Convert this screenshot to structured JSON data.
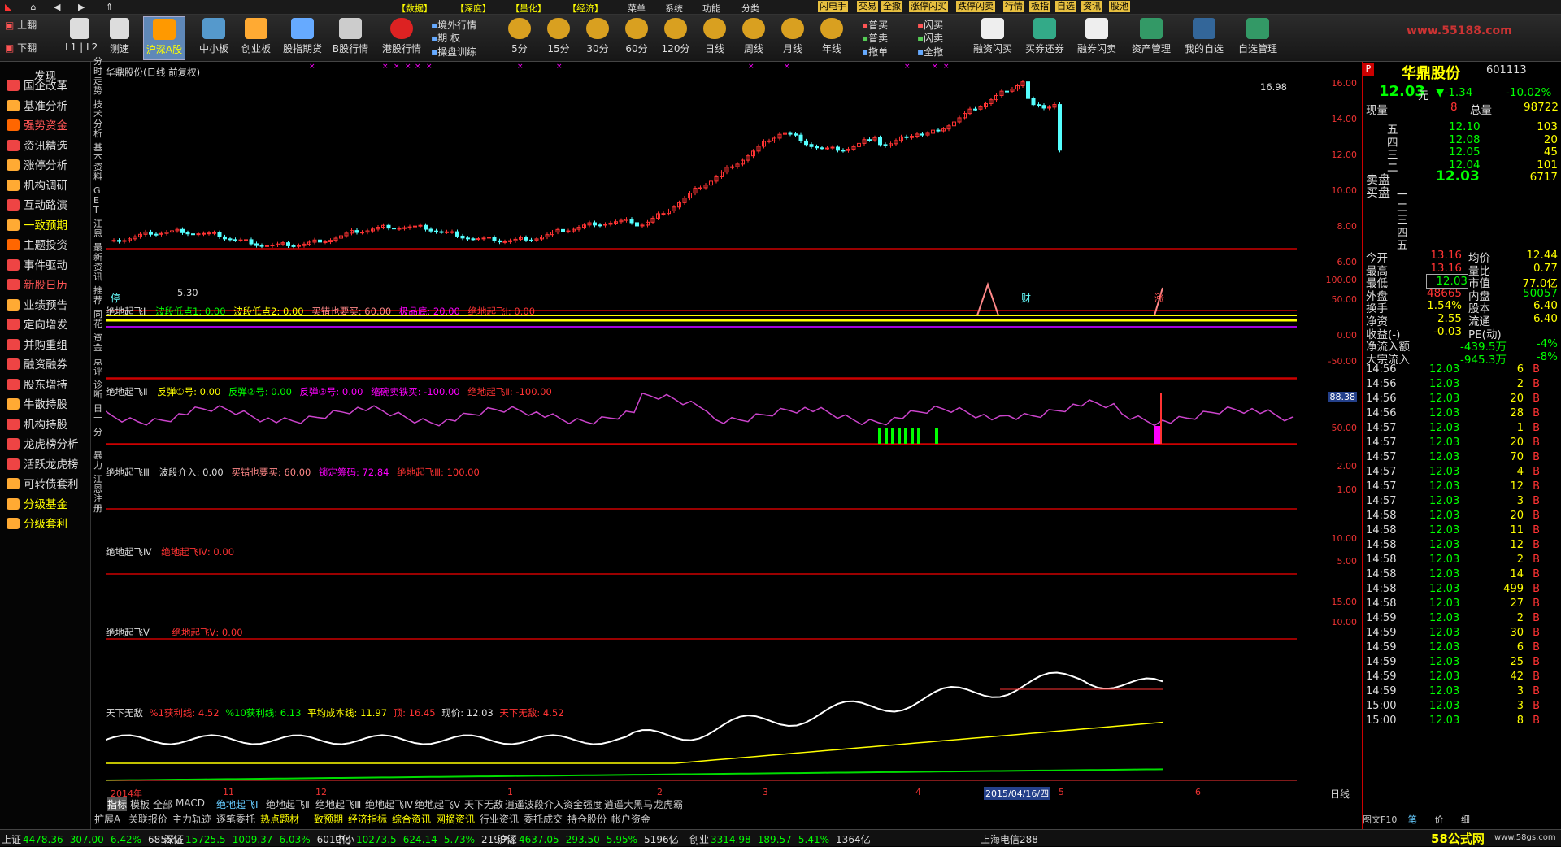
{
  "menubar": {
    "items": [
      "上翻",
      "下翻",
      "数据",
      "深度",
      "量化",
      "经济",
      "菜单",
      "系统",
      "功能",
      "分类",
      "闪电手",
      "交易",
      "全撒",
      "涨停闪买",
      "跌停闪卖",
      "行情",
      "板指",
      "自选",
      "资讯",
      "股池"
    ]
  },
  "toolbar": {
    "nav": [
      "上翻",
      "下翻"
    ],
    "l1l2": "L1 | L2",
    "buttons": [
      "测速",
      "沪深A股",
      "中小板",
      "创业板",
      "股指期货",
      "B股行情",
      "港股行情"
    ],
    "small": [
      "境外行情",
      "期 权",
      "操盘训练"
    ],
    "periods": [
      "5分",
      "15分",
      "30分",
      "60分",
      "120分",
      "日线",
      "周线",
      "月线",
      "年线"
    ],
    "trade1": [
      "普买",
      "普卖",
      "撤单"
    ],
    "trade2": [
      "闪买",
      "闪卖",
      "全撤"
    ],
    "right": [
      "融资闪买",
      "买券还券",
      "融券闪卖",
      "资产管理",
      "我的自选",
      "自选管理"
    ],
    "logo": "www.55188.com"
  },
  "sidebar": {
    "header": "发现",
    "items": [
      "国企改革",
      "基准分析",
      "强势资金",
      "资讯精选",
      "涨停分析",
      "机构调研",
      "互动路演",
      "一致预期",
      "主题投资",
      "事件驱动",
      "新股日历",
      "业绩预告",
      "定向增发",
      "并购重组",
      "融资融券",
      "股东增持",
      "牛散持股",
      "机构持股",
      "龙虎榜分析",
      "活跃龙虎榜",
      "可转债套利",
      "分级基金",
      "分级套利"
    ]
  },
  "vtabs": [
    "分时走势",
    "技术分析",
    "基本资料",
    "GET",
    "江恩",
    "最新资讯",
    "推荐",
    "同花",
    "资金",
    "点评",
    "诊断",
    "日十",
    "分十",
    "暴力",
    "江恩注册"
  ],
  "chart": {
    "title": "华鼎股份(日线 前复权)",
    "high_label": "16.98",
    "low_label": "5.30",
    "markers": [
      "停",
      "财",
      "涨"
    ],
    "ind1": {
      "name": "绝地起飞Ⅰ",
      "items": [
        "波段低点1: 0.00",
        "波段低点2: 0.00",
        "买错也要买: 60.00",
        "极品底: 20.00",
        "绝地起飞Ⅰ: 0.00"
      ]
    },
    "ind2": {
      "name": "绝地起飞Ⅱ",
      "items": [
        "反弹①号: 0.00",
        "反弹②号: 0.00",
        "反弹③号: 0.00",
        "缩碗卖铁买: -100.00",
        "绝地起飞Ⅱ: -100.00"
      ]
    },
    "ind3": {
      "name": "绝地起飞Ⅲ",
      "items": [
        "波段介入: 0.00",
        "买错也要买: 60.00",
        "锁定筹码: 72.84",
        "绝地起飞Ⅲ: 100.00"
      ]
    },
    "ind4": {
      "name": "绝地起飞Ⅳ",
      "items": [
        "绝地起飞Ⅳ: 0.00"
      ]
    },
    "ind5": {
      "name": "绝地起飞Ⅴ",
      "items": [
        "绝地起飞Ⅴ: 0.00"
      ]
    },
    "ind6": {
      "name": "天下无敌",
      "items": [
        "%1获利线: 4.52",
        "%10获利线: 6.13",
        "平均成本线: 11.97",
        "顶: 16.45",
        "现价: 12.03",
        "天下无敌: 4.52"
      ]
    },
    "xaxis": [
      "2014年",
      "11",
      "12",
      "1",
      "2",
      "3",
      "4",
      "2015/04/16/四",
      "5",
      "6"
    ],
    "axis_label": "日线"
  },
  "axis": {
    "price": [
      "16.00",
      "14.00",
      "12.00",
      "10.00",
      "8.00",
      "6.00"
    ],
    "ind1": [
      "100.00",
      "50.00",
      "0.00"
    ],
    "ind2": [
      "-50.00"
    ],
    "ind3_label": "88.38",
    "ind3": [
      "50.00"
    ],
    "ind4": [
      "2.00",
      "1.00"
    ],
    "ind5": [
      "10.00",
      "5.00"
    ],
    "ind6": [
      "15.00",
      "10.00"
    ]
  },
  "rpanel": {
    "name": "华鼎股份",
    "code": "601113",
    "price": "12.03",
    "unit": "元",
    "change": "▼-1.34",
    "pct": "-10.02%",
    "xianliang_label": "现量",
    "xianliang_value": "8",
    "zongliang_label": "总量",
    "zongliang_value": "98722",
    "asks": [
      [
        "五",
        "12.10",
        "103"
      ],
      [
        "四",
        "12.08",
        "20"
      ],
      [
        "三",
        "12.05",
        "45"
      ],
      [
        "二",
        "12.04",
        "101"
      ],
      [
        "一",
        "12.03",
        "6717"
      ]
    ],
    "sell_label": "卖盘",
    "buy_label": "买盘",
    "bids": [
      "一",
      "二",
      "三",
      "四",
      "五"
    ],
    "stats": [
      [
        "今开",
        "13.16",
        "均价",
        "12.44"
      ],
      [
        "最高",
        "13.16",
        "量比",
        "0.77"
      ],
      [
        "最低",
        "12.03",
        "市值",
        "77.0亿"
      ],
      [
        "外盘",
        "48665",
        "内盘",
        "50057"
      ],
      [
        "换手",
        "1.54%",
        "股本",
        "6.40"
      ],
      [
        "净资",
        "2.55",
        "流通",
        "6.40"
      ],
      [
        "收益(-)",
        "-0.03",
        "PE(动)",
        ""
      ]
    ],
    "flow": [
      [
        "净流入额",
        "-439.5万",
        "-4%"
      ],
      [
        "大宗流入",
        "-945.3万",
        "-8%"
      ]
    ],
    "ticks": [
      [
        "14:56",
        "12.03",
        "6",
        "B"
      ],
      [
        "14:56",
        "12.03",
        "2",
        "B"
      ],
      [
        "14:56",
        "12.03",
        "20",
        "B"
      ],
      [
        "14:56",
        "12.03",
        "28",
        "B"
      ],
      [
        "14:57",
        "12.03",
        "1",
        "B"
      ],
      [
        "14:57",
        "12.03",
        "20",
        "B"
      ],
      [
        "14:57",
        "12.03",
        "70",
        "B"
      ],
      [
        "14:57",
        "12.03",
        "4",
        "B"
      ],
      [
        "14:57",
        "12.03",
        "12",
        "B"
      ],
      [
        "14:57",
        "12.03",
        "3",
        "B"
      ],
      [
        "14:58",
        "12.03",
        "20",
        "B"
      ],
      [
        "14:58",
        "12.03",
        "11",
        "B"
      ],
      [
        "14:58",
        "12.03",
        "12",
        "B"
      ],
      [
        "14:58",
        "12.03",
        "2",
        "B"
      ],
      [
        "14:58",
        "12.03",
        "14",
        "B"
      ],
      [
        "14:58",
        "12.03",
        "499",
        "B"
      ],
      [
        "14:58",
        "12.03",
        "27",
        "B"
      ],
      [
        "14:59",
        "12.03",
        "2",
        "B"
      ],
      [
        "14:59",
        "12.03",
        "30",
        "B"
      ],
      [
        "14:59",
        "12.03",
        "6",
        "B"
      ],
      [
        "14:59",
        "12.03",
        "25",
        "B"
      ],
      [
        "14:59",
        "12.03",
        "42",
        "B"
      ],
      [
        "14:59",
        "12.03",
        "3",
        "B"
      ],
      [
        "15:00",
        "12.03",
        "3",
        "B"
      ],
      [
        "15:00",
        "12.03",
        "8",
        "B"
      ]
    ],
    "bottom": [
      "图文F10",
      "笔",
      "价",
      "细"
    ]
  },
  "bottomtabs": [
    "指标",
    "模板",
    "全部",
    "MACD",
    "绝地起飞Ⅰ",
    "绝地起飞Ⅱ",
    "绝地起飞Ⅲ",
    "绝地起飞Ⅳ",
    "绝地起飞Ⅴ",
    "天下无敌",
    "逍遥波段介入",
    "资金强度",
    "逍遥大黑马",
    "龙虎霸"
  ],
  "bottomtabs2": [
    "扩展A",
    "关联报价",
    "主力轨迹",
    "逐笔委托",
    "热点题材",
    "一致预期",
    "经济指标",
    "综合资讯",
    "网摘资讯",
    "行业资讯",
    "委托成交",
    "持仓股份",
    "帐户资金"
  ],
  "status": {
    "items": [
      [
        "上证",
        "4478.36 -307.00 -6.42%",
        "6855亿"
      ],
      [
        "深证",
        "15725.5 -1009.37 -6.03%",
        "6012亿"
      ],
      [
        "中小",
        "10273.5 -624.14 -5.73%",
        "2199亿"
      ],
      [
        "沪深",
        "4637.05 -293.50 -5.95%",
        "5196亿"
      ],
      [
        "创业",
        "3314.98 -189.57 -5.41%",
        "1364亿"
      ]
    ],
    "net": "上海电信288",
    "watermark": "58公式网",
    "watermark_url": "www.58gs.com"
  }
}
